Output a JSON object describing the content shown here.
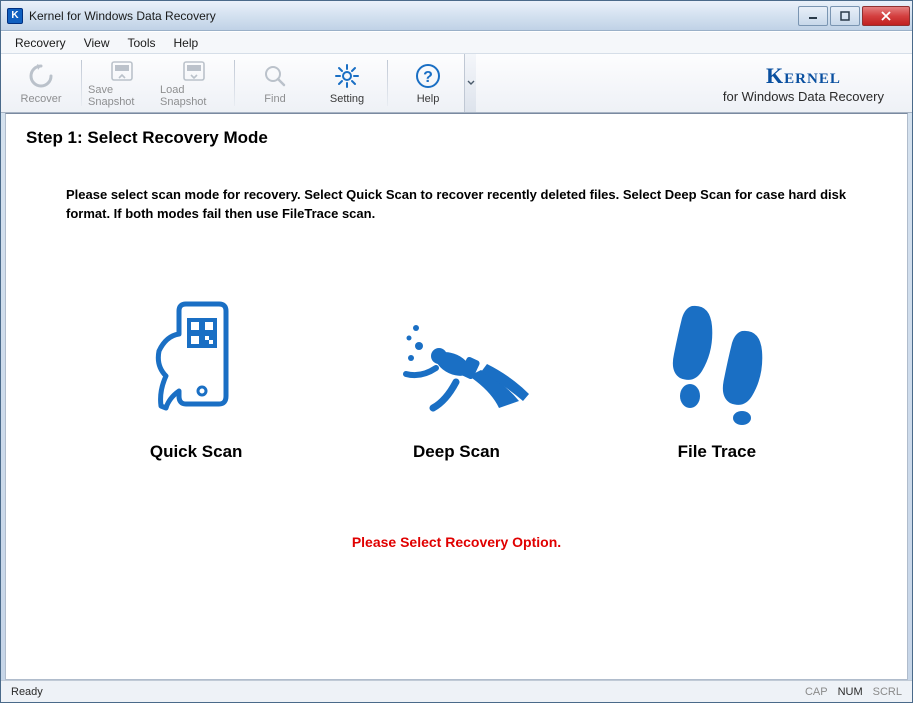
{
  "window": {
    "title": "Kernel for Windows Data Recovery"
  },
  "menu": {
    "items": [
      "Recovery",
      "View",
      "Tools",
      "Help"
    ]
  },
  "toolbar": {
    "recover": "Recover",
    "save_snapshot": "Save Snapshot",
    "load_snapshot": "Load Snapshot",
    "find": "Find",
    "setting": "Setting",
    "help": "Help"
  },
  "brand": {
    "name": "Kernel",
    "subtitle": "for Windows Data Recovery"
  },
  "main": {
    "heading": "Step 1: Select Recovery Mode",
    "instructions": "Please select scan mode for recovery. Select Quick Scan to recover recently deleted files. Select Deep Scan for case hard disk format. If both modes fail then use FileTrace scan.",
    "options": {
      "quick": "Quick Scan",
      "deep": "Deep Scan",
      "filetrace": "File Trace"
    },
    "prompt": "Please Select Recovery Option."
  },
  "status": {
    "ready": "Ready",
    "cap": "CAP",
    "num": "NUM",
    "scrl": "SCRL"
  },
  "colors": {
    "accent": "#1a6fc4",
    "error": "#e00000"
  }
}
